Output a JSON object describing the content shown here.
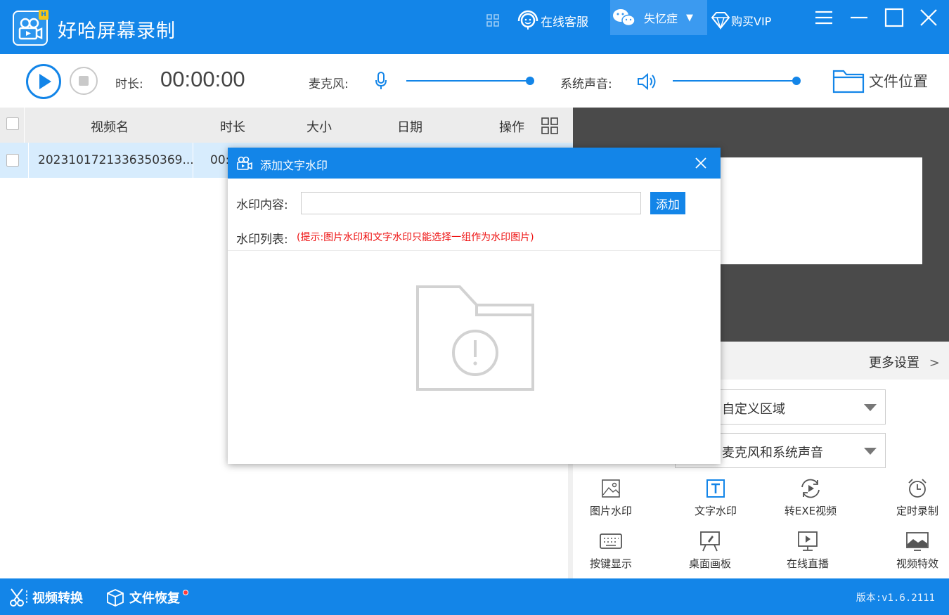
{
  "app": {
    "title": "好哈屏幕录制",
    "logo_badge": "H"
  },
  "titlebar": {
    "service_label": "在线客服",
    "username": "失忆症",
    "vip_label": "购买VIP"
  },
  "toolbar": {
    "duration_label": "时长:",
    "duration_value": "00:00:00",
    "mic_label": "麦克风:",
    "mic_level": 1.0,
    "system_sound_label": "系统声音:",
    "system_sound_level": 1.0,
    "file_location_label": "文件位置"
  },
  "table": {
    "headers": [
      "视频名",
      "时长",
      "大小",
      "日期",
      "操作"
    ],
    "rows": [
      {
        "name": "2023101721336350369...",
        "duration": "00:"
      }
    ]
  },
  "settings": {
    "more_settings": "更多设置",
    "area_select": "自定义区域",
    "audio_select": "麦克风和系统声音"
  },
  "tools": [
    {
      "label": "图片水印",
      "icon": "image-watermark-icon"
    },
    {
      "label": "文字水印",
      "icon": "text-watermark-icon"
    },
    {
      "label": "转EXE视频",
      "icon": "exe-convert-icon"
    },
    {
      "label": "定时录制",
      "icon": "alarm-clock-icon"
    },
    {
      "label": "按键显示",
      "icon": "keyboard-icon"
    },
    {
      "label": "桌面画板",
      "icon": "drawing-board-icon"
    },
    {
      "label": "在线直播",
      "icon": "live-stream-icon"
    },
    {
      "label": "视频特效",
      "icon": "video-effects-icon"
    }
  ],
  "footer": {
    "video_convert": "视频转换",
    "file_recovery": "文件恢复",
    "version": "版本:v1.6.2111"
  },
  "modal": {
    "title": "添加文字水印",
    "content_label": "水印内容:",
    "content_value": "",
    "add_button": "添加",
    "list_label": "水印列表:",
    "hint": "(提示:图片水印和文字水印只能选择一组作为水印图片)"
  },
  "colors": {
    "primary": "#1385e8",
    "hint_red": "#ee1111",
    "row_selected": "#d7ecfd"
  }
}
